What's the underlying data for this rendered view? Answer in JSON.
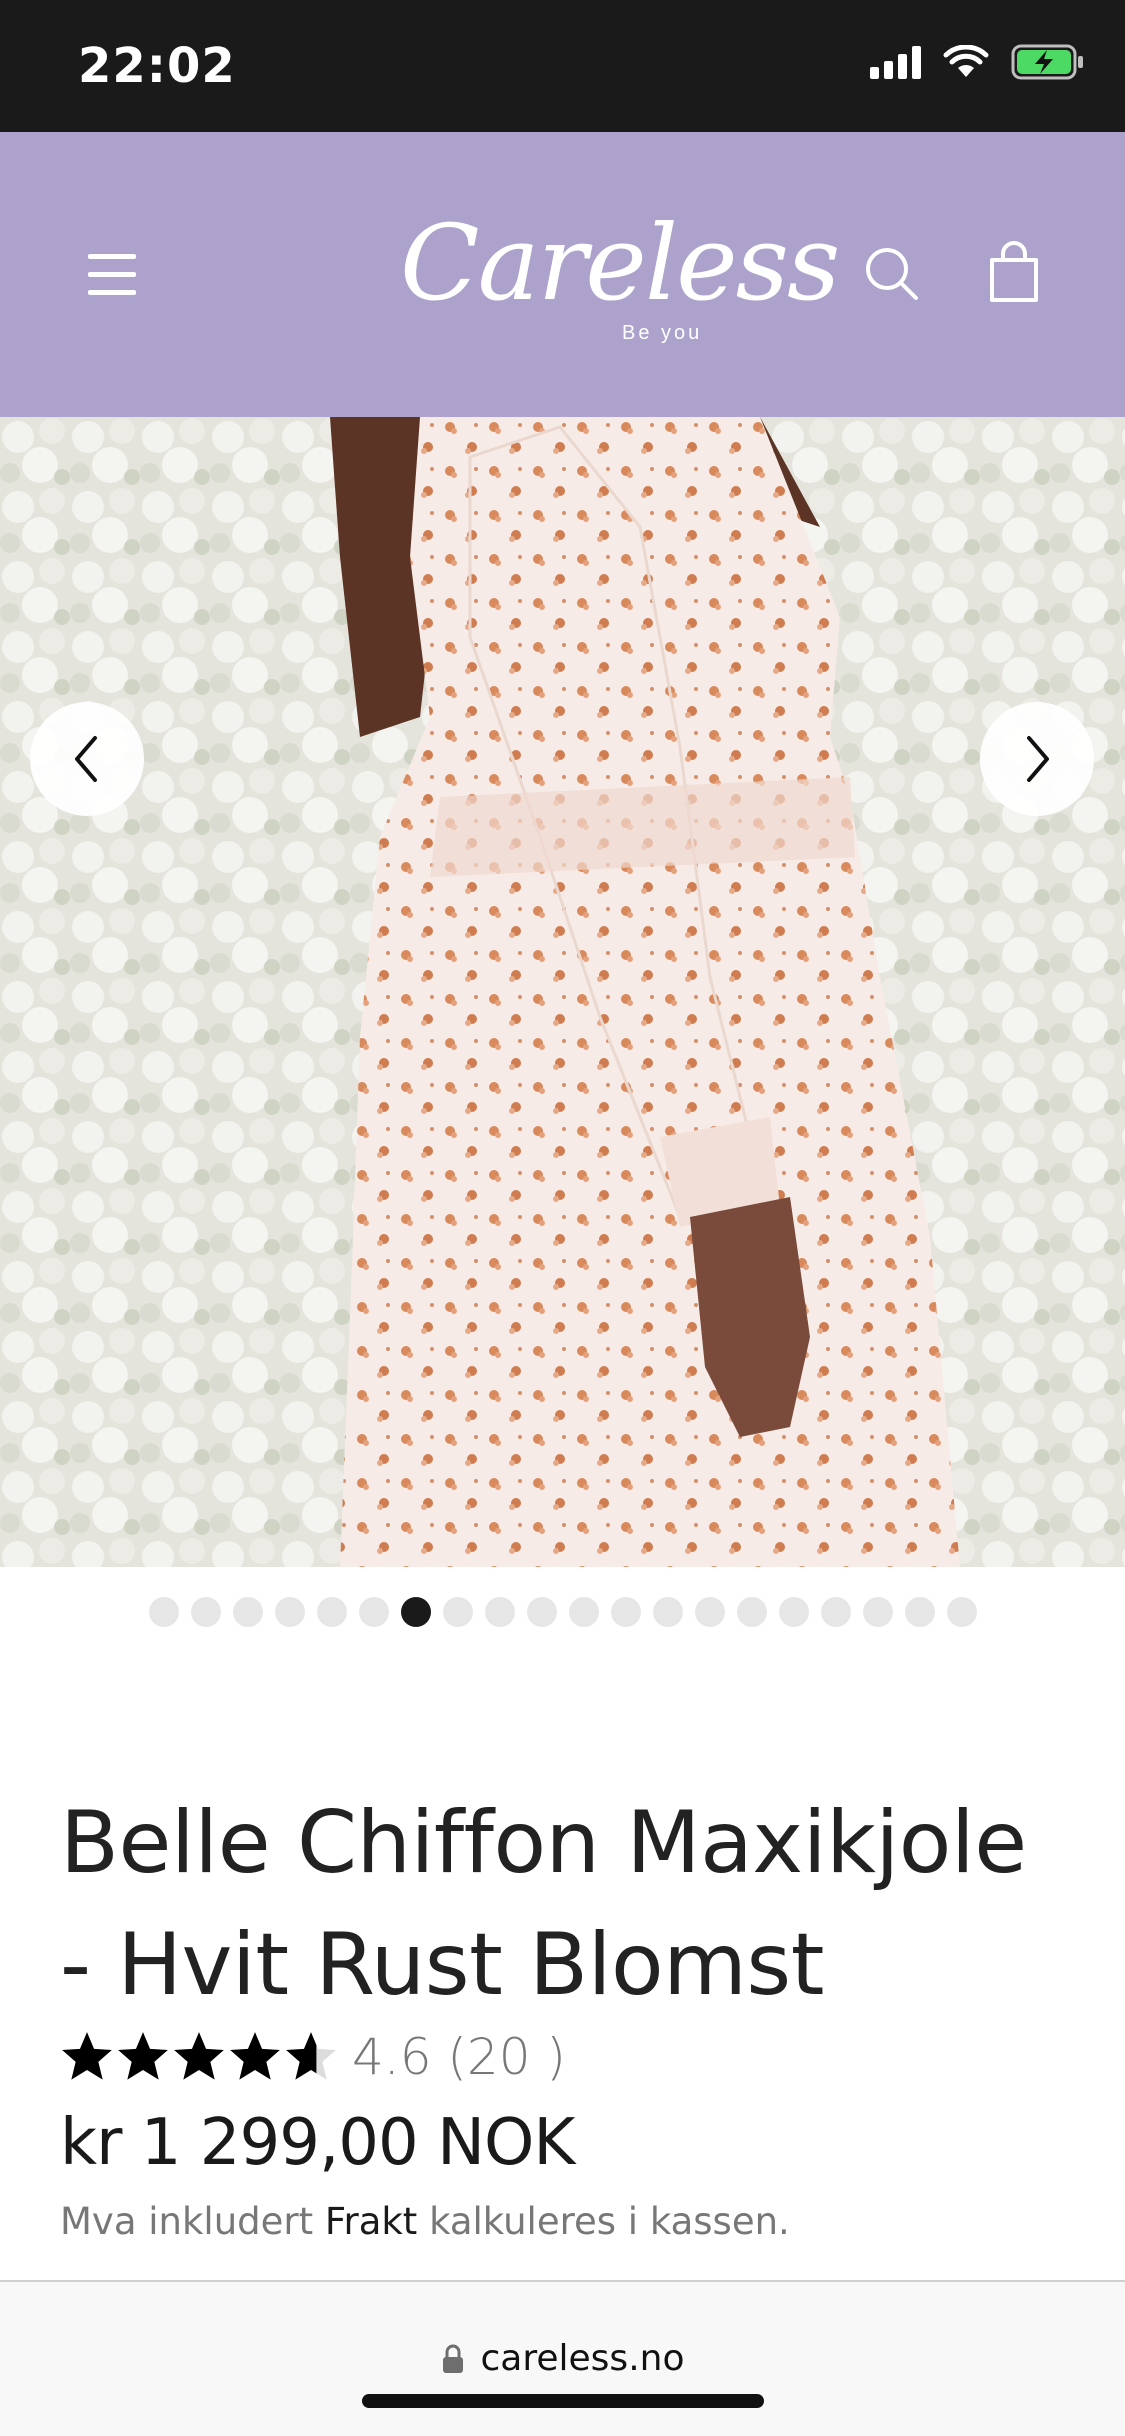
{
  "status_bar": {
    "time": "22:02",
    "icons": [
      "signal-icon",
      "wifi-icon",
      "battery-charging-icon"
    ]
  },
  "header": {
    "background_color": "#ada2cb",
    "logo_text": "Careless",
    "logo_tagline": "Be you",
    "icons": [
      "hamburger-menu-icon",
      "search-icon",
      "shopping-bag-icon"
    ]
  },
  "gallery": {
    "icons": [
      "chevron-left-icon",
      "chevron-right-icon"
    ],
    "image_count": 20,
    "active_index": 6
  },
  "product": {
    "title": "Belle Chiffon Maxikjole - Hvit Rust Blomst",
    "rating_value": 4.6,
    "rating_max": 5,
    "rating_text": "4.6 (20 )",
    "price": "kr 1 299,00 NOK",
    "tax_prefix": "Mva inkludert",
    "shipping_link": "Frakt",
    "tax_suffix": "kalkuleres i kassen."
  },
  "browser": {
    "url": "careless.no",
    "icons": [
      "lock-icon"
    ]
  }
}
